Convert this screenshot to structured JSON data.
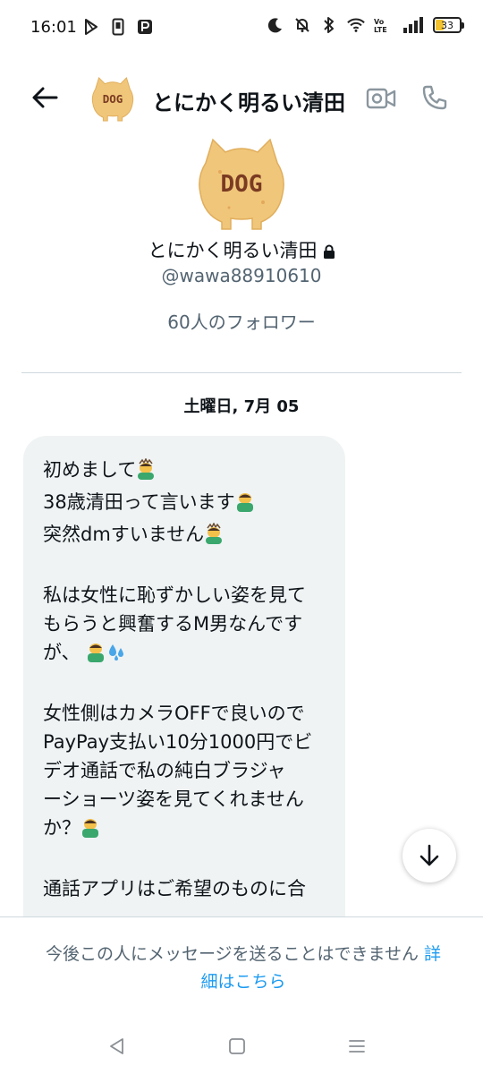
{
  "status_bar": {
    "time": "16:01",
    "battery": "33",
    "icons": [
      "play-store-icon",
      "phone-app-icon",
      "paypay-icon",
      "moon-icon",
      "mute-icon",
      "bluetooth-icon",
      "wifi-icon",
      "volte-icon",
      "signal-icon"
    ]
  },
  "header": {
    "title": "とにかく明るい清田",
    "avatar_text": "DOG"
  },
  "profile": {
    "avatar_text": "DOG",
    "name": "とにかく明るい清田",
    "handle": "@wawa88910610",
    "followers": "60人のフォロワー"
  },
  "date_separator": "土曜日, 7月 05",
  "message": {
    "lines": [
      "初めまして",
      "38歳清田って言います",
      "突然dmすいません",
      "",
      "私は女性に恥ずかしい姿を見て",
      "もらうと興奮するM男なんです",
      "が、",
      "",
      "女性側はカメラOFFで良いので",
      "PayPay支払い10分1000円でビ",
      "デオ通話で私の純白ブラジャ",
      "ーショーツ姿を見てくれません",
      "か？",
      "",
      "通話アプリはご希望のものに合"
    ]
  },
  "footer": {
    "notice": "今後この人にメッセージを送ることはできません",
    "link_a": "詳",
    "link_b": "細はこちら"
  },
  "colors": {
    "accent": "#1d9bf0",
    "bubble": "#eff3f4",
    "secondary_text": "#536471"
  }
}
